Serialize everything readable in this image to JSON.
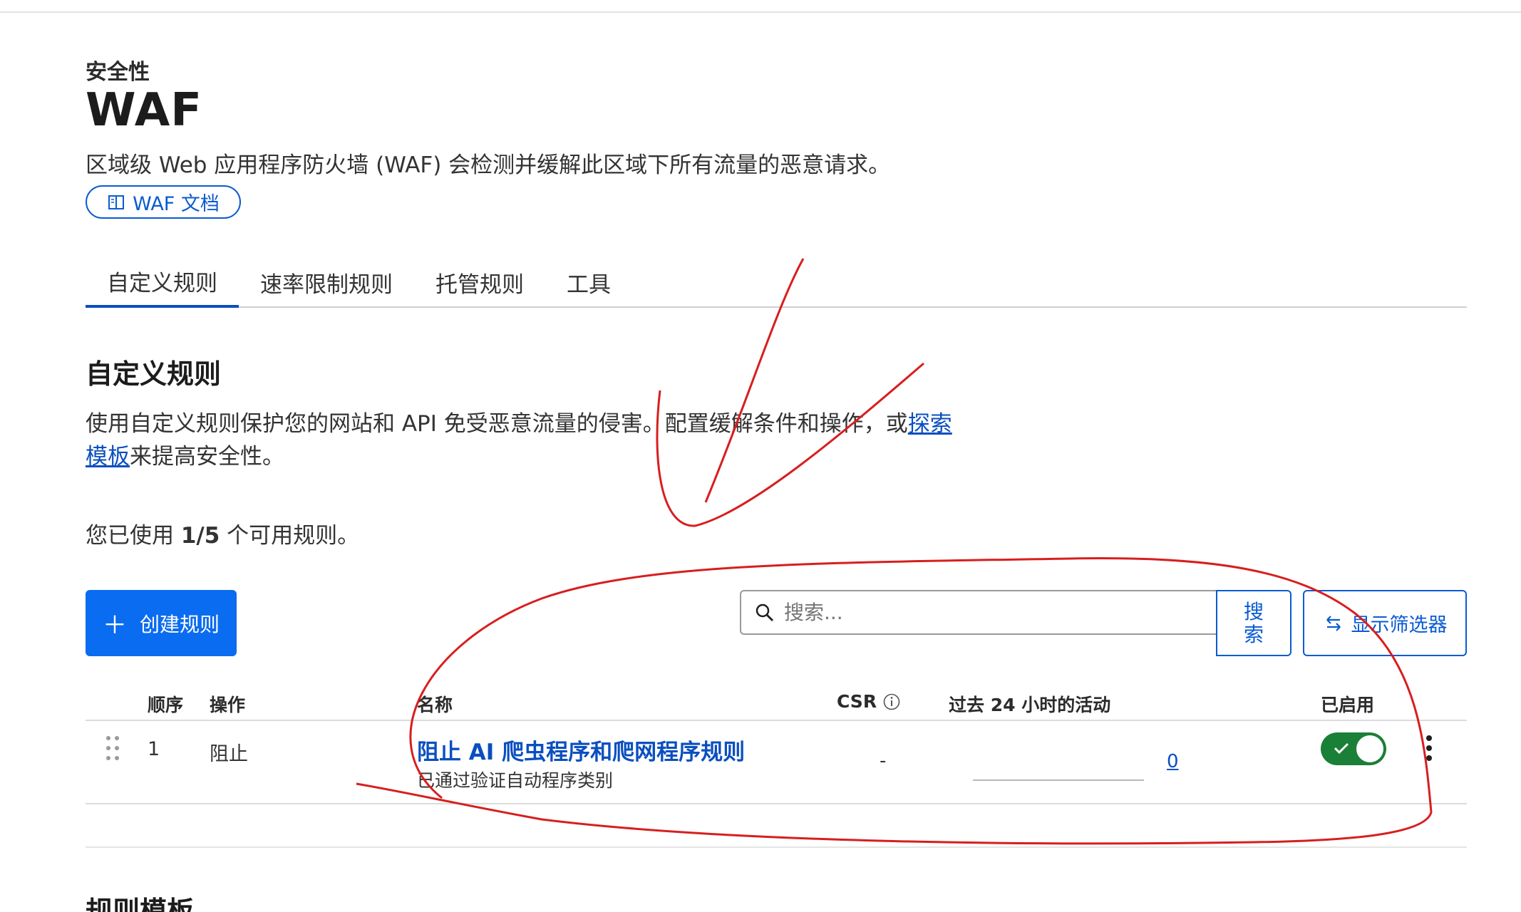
{
  "header": {
    "breadcrumb": "安全性",
    "title": "WAF",
    "description": "区域级 Web 应用程序防火墙 (WAF) 会检测并缓解此区域下所有流量的恶意请求。",
    "docs_button": "WAF 文档"
  },
  "tabs": [
    {
      "label": "自定义规则",
      "active": true
    },
    {
      "label": "速率限制规则",
      "active": false
    },
    {
      "label": "托管规则",
      "active": false
    },
    {
      "label": "工具",
      "active": false
    }
  ],
  "section": {
    "title": "自定义规则",
    "description_prefix": "使用自定义规则保护您的网站和 API 免受恶意流量的侵害。配置缓解条件和操作，或",
    "description_link": "探索模板",
    "description_suffix": "来提高安全性。",
    "usage_prefix": "您已使用 ",
    "usage_count": "1/5",
    "usage_suffix": " 个可用规则。"
  },
  "toolbar": {
    "create_button": "创建规则",
    "create_icon": "plus-icon",
    "search_placeholder": "搜索...",
    "search_button_line1": "搜",
    "search_button_line2": "索",
    "filter_button": "显示筛选器"
  },
  "table": {
    "headers": {
      "order": "顺序",
      "action": "操作",
      "name": "名称",
      "csr": "CSR",
      "activity": "过去 24 小时的活动",
      "enabled": "已启用"
    },
    "rows": [
      {
        "order": "1",
        "action": "阻止",
        "name": "阻止 AI 爬虫程序和爬网程序规则",
        "subtitle": "已通过验证自动程序类别",
        "csr": "-",
        "activity": "0",
        "enabled": true
      }
    ]
  },
  "templates": {
    "title": "规则模板"
  },
  "colors": {
    "accent": "#0a6cf0",
    "link": "#0a4fbf",
    "toggle_on": "#1a7f37",
    "annotation": "#d81e1e"
  }
}
